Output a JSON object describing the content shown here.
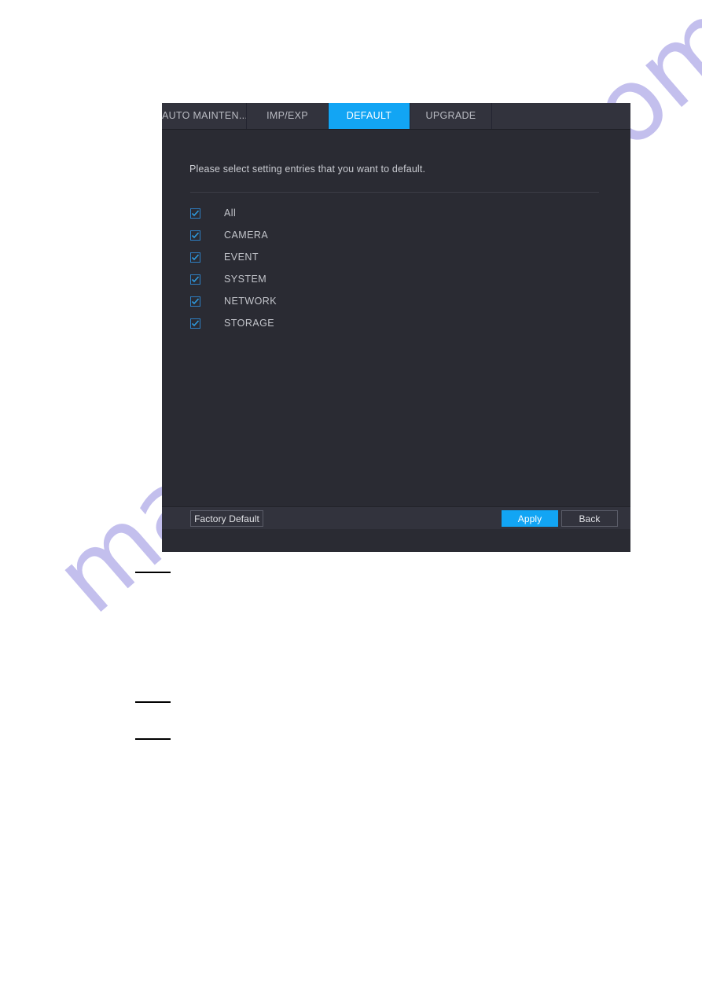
{
  "page": {
    "background_color": "#ffffff",
    "watermark_text": "manualshive.com",
    "watermark_color": "#b9b4ea"
  },
  "dialog": {
    "background_color": "#2a2b33",
    "accent_color": "#12a5f4",
    "tabbar": {
      "tabs": [
        {
          "label": "AUTO MAINTEN...",
          "active": false
        },
        {
          "label": "IMP/EXP",
          "active": false
        },
        {
          "label": "DEFAULT",
          "active": true
        },
        {
          "label": "UPGRADE",
          "active": false
        }
      ]
    },
    "content": {
      "instruction": "Please select setting entries that you want to default.",
      "checklist": [
        {
          "label": "All",
          "checked": true
        },
        {
          "label": "CAMERA",
          "checked": true
        },
        {
          "label": "EVENT",
          "checked": true
        },
        {
          "label": "SYSTEM",
          "checked": true
        },
        {
          "label": "NETWORK",
          "checked": true
        },
        {
          "label": "STORAGE",
          "checked": true
        }
      ]
    },
    "footer": {
      "factory_default_label": "Factory Default",
      "apply_label": "Apply",
      "back_label": "Back"
    }
  }
}
